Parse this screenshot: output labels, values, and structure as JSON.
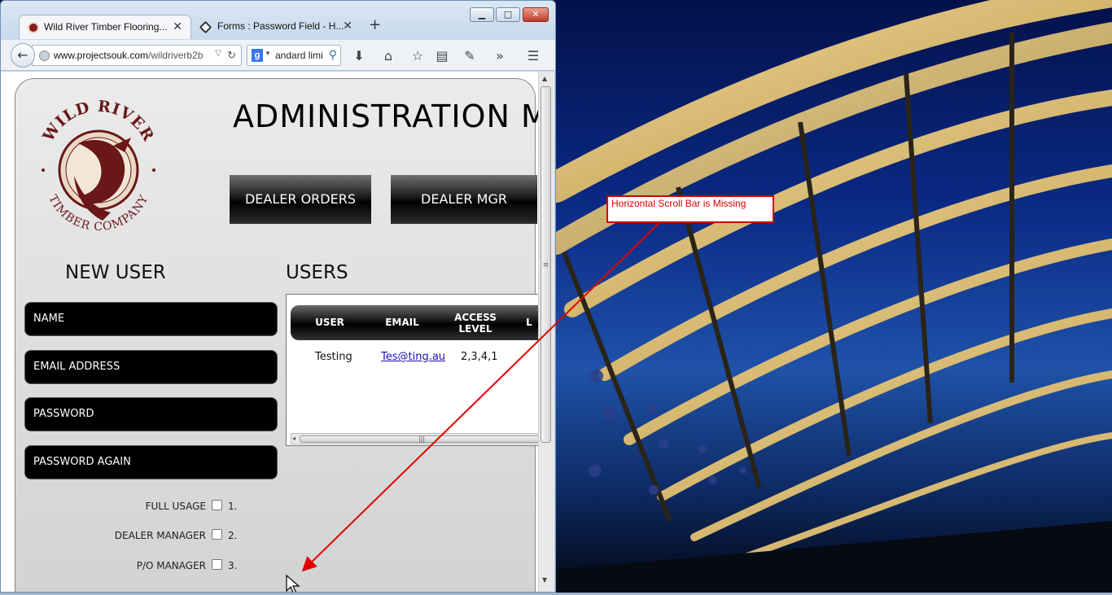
{
  "browser": {
    "tabs": [
      {
        "label": "Wild River Timber Flooring...",
        "icon": "wild-river-favicon",
        "active": true
      },
      {
        "label": "Forms : Password Field - H...",
        "icon": "forms-favicon",
        "active": false
      }
    ],
    "url_host": "www.projectsouk.com",
    "url_path": "/wildriverb2b",
    "search_text": "andard limi",
    "window_buttons": {
      "minimize": "▭",
      "maximize": "□",
      "close": "✕"
    }
  },
  "page": {
    "logo": {
      "top_text": "WILD RIVER",
      "bottom_text": "TIMBER COMPANY"
    },
    "title": "ADMINISTRATION M",
    "nav_buttons": {
      "dealer_orders": "DEALER ORDERS",
      "dealer_mgr": "DEALER MGR"
    },
    "new_user": {
      "title": "NEW USER",
      "fields": {
        "name": "NAME",
        "email": "EMAIL ADDRESS",
        "password": "PASSWORD",
        "password_again": "PASSWORD AGAIN"
      },
      "permissions": [
        {
          "label": "FULL USAGE",
          "number": "1.",
          "checked": false
        },
        {
          "label": "DEALER MANAGER",
          "number": "2.",
          "checked": false
        },
        {
          "label": "P/O MANAGER",
          "number": "3.",
          "checked": false
        }
      ]
    },
    "users": {
      "title": "USERS",
      "columns": [
        "USER",
        "EMAIL",
        "ACCESS LEVEL",
        "L"
      ],
      "rows": [
        {
          "user": "Testing",
          "email": "Tes@ting.au",
          "access_level": "2,3,4,1"
        }
      ]
    }
  },
  "annotation": {
    "text": "Horizontal Scroll Bar is Missing",
    "color": "#d40000"
  },
  "colors": {
    "accent_red": "#d40000",
    "button_black": "#000000",
    "logo_maroon": "#6a1717"
  }
}
